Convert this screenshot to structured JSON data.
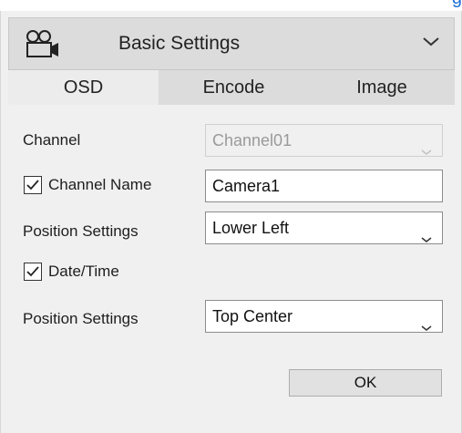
{
  "top_strip": {
    "text": "g"
  },
  "header": {
    "title": "Basic Settings",
    "icon": "camera-icon",
    "collapse_icon": "chevron-down-icon"
  },
  "tabs": [
    {
      "label": "OSD",
      "active": true
    },
    {
      "label": "Encode",
      "active": false
    },
    {
      "label": "Image",
      "active": false
    }
  ],
  "form": {
    "channel": {
      "label": "Channel",
      "value": "Channel01",
      "disabled": true
    },
    "channel_name": {
      "label": "Channel Name",
      "checked": true,
      "value": "Camera1"
    },
    "position_1": {
      "label": "Position Settings",
      "value": "Lower Left"
    },
    "date_time": {
      "label": "Date/Time",
      "checked": true
    },
    "position_2": {
      "label": "Position Settings",
      "value": "Top Center"
    }
  },
  "buttons": {
    "ok_label": "OK"
  },
  "colors": {
    "accent": "#1f6fd6",
    "panel": "#f0f0f0",
    "header": "#dcdcdc"
  }
}
